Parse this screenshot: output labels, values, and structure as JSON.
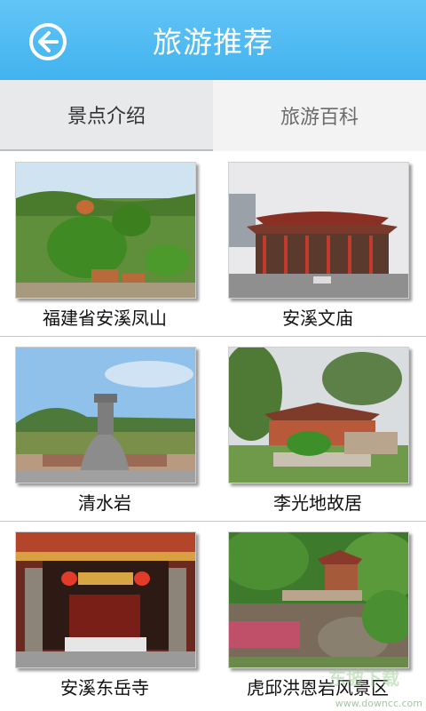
{
  "header": {
    "title": "旅游推荐",
    "back_icon": "back-arrow-circle-icon"
  },
  "tabs": [
    {
      "label": "景点介绍",
      "active": true
    },
    {
      "label": "旅游百科",
      "active": false
    }
  ],
  "attractions": [
    {
      "name": "福建省安溪凤山"
    },
    {
      "name": "安溪文庙"
    },
    {
      "name": "清水岩"
    },
    {
      "name": "李光地故居"
    },
    {
      "name": "安溪东岳寺"
    },
    {
      "name": "虎邱洪恩岩风景区"
    }
  ],
  "watermark": {
    "large": "东坡下载",
    "small": "www.downcc.com"
  }
}
